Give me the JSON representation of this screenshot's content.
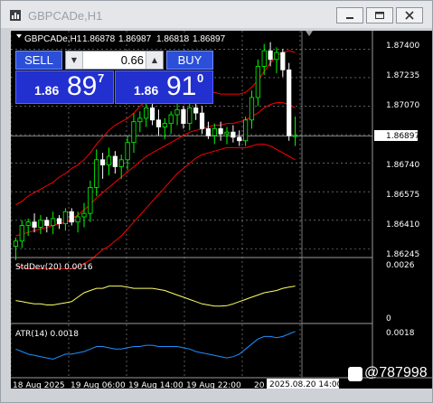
{
  "window": {
    "title": "GBPCADe,H1",
    "controls": [
      "minimize-icon",
      "maximize-icon",
      "close-icon"
    ]
  },
  "chart_header": {
    "symbol": "GBPCADe,H1",
    "open": "1.86878",
    "high": "1.86987",
    "low": "1.86818",
    "close": "1.86897"
  },
  "one_click": {
    "sell_label": "SELL",
    "buy_label": "BUY",
    "lot_value": "0.66",
    "sell_small": "1.86",
    "sell_big": "89",
    "sell_sup": "7",
    "buy_small": "1.86",
    "buy_big": "91",
    "buy_sup": "0"
  },
  "price_axis": [
    "1.87400",
    "1.87235",
    "1.87070",
    "1.86897",
    "1.86740",
    "1.86575",
    "1.86410",
    "1.86245"
  ],
  "current_price": "1.86897",
  "stddev": {
    "label": "StdDev(20) 0.0016",
    "top": "0.0026",
    "bottom": "0"
  },
  "atr": {
    "label": "ATR(14) 0.0018",
    "top": "0.0018"
  },
  "time_axis": [
    "18 Aug 2025",
    "19 Aug 06:00",
    "19 Aug 14:00",
    "19 Aug 22:00",
    "20 Aug"
  ],
  "crosshair_time": "2025.08.20 14:00",
  "watermark": "@787998",
  "colors": {
    "bull": "#00ff00",
    "bear": "#ffffff",
    "bands": "#ff0000",
    "stddev": "#ffff66",
    "atr": "#1e90ff",
    "grid": "#9a9a9a"
  },
  "chart_data": {
    "type": "candlestick",
    "ylim": [
      1.862,
      1.8748
    ],
    "candles": [
      [
        1.8626,
        1.8631,
        1.8618,
        1.8629
      ],
      [
        1.8629,
        1.8641,
        1.8625,
        1.8638
      ],
      [
        1.8638,
        1.8642,
        1.8632,
        1.864
      ],
      [
        1.864,
        1.8645,
        1.8634,
        1.8637
      ],
      [
        1.8637,
        1.8644,
        1.8633,
        1.8641
      ],
      [
        1.8641,
        1.8643,
        1.8634,
        1.8638
      ],
      [
        1.8638,
        1.8646,
        1.8633,
        1.8642
      ],
      [
        1.8642,
        1.8644,
        1.8636,
        1.8639
      ],
      [
        1.8639,
        1.8648,
        1.8635,
        1.8646
      ],
      [
        1.8646,
        1.8648,
        1.8638,
        1.864
      ],
      [
        1.864,
        1.8646,
        1.8634,
        1.8643
      ],
      [
        1.8643,
        1.8651,
        1.8637,
        1.8645
      ],
      [
        1.8645,
        1.8664,
        1.864,
        1.866
      ],
      [
        1.866,
        1.8682,
        1.8655,
        1.8676
      ],
      [
        1.8676,
        1.868,
        1.8665,
        1.8673
      ],
      [
        1.8673,
        1.8683,
        1.8667,
        1.8678
      ],
      [
        1.8678,
        1.8681,
        1.8668,
        1.8672
      ],
      [
        1.8672,
        1.8679,
        1.8665,
        1.8676
      ],
      [
        1.8676,
        1.869,
        1.867,
        1.8686
      ],
      [
        1.8686,
        1.8703,
        1.868,
        1.8698
      ],
      [
        1.8698,
        1.8704,
        1.8692,
        1.87
      ],
      [
        1.87,
        1.8712,
        1.8695,
        1.8706
      ],
      [
        1.8706,
        1.871,
        1.8696,
        1.8699
      ],
      [
        1.8699,
        1.8705,
        1.869,
        1.8695
      ],
      [
        1.8695,
        1.87,
        1.8688,
        1.8697
      ],
      [
        1.8697,
        1.8704,
        1.8691,
        1.8702
      ],
      [
        1.8702,
        1.8709,
        1.8696,
        1.8705
      ],
      [
        1.8705,
        1.8707,
        1.8694,
        1.8697
      ],
      [
        1.8697,
        1.8709,
        1.8693,
        1.8706
      ],
      [
        1.8706,
        1.8712,
        1.8699,
        1.8703
      ],
      [
        1.8703,
        1.8707,
        1.8691,
        1.8694
      ],
      [
        1.8694,
        1.8698,
        1.8688,
        1.869
      ],
      [
        1.869,
        1.8697,
        1.8685,
        1.8694
      ],
      [
        1.8694,
        1.8698,
        1.8687,
        1.8691
      ],
      [
        1.8691,
        1.8695,
        1.8685,
        1.8692
      ],
      [
        1.8692,
        1.8696,
        1.8686,
        1.8689
      ],
      [
        1.8689,
        1.8693,
        1.8684,
        1.8687
      ],
      [
        1.8687,
        1.8701,
        1.8684,
        1.8699
      ],
      [
        1.8699,
        1.8716,
        1.8694,
        1.8712
      ],
      [
        1.8712,
        1.8734,
        1.8707,
        1.873
      ],
      [
        1.873,
        1.8743,
        1.8725,
        1.8739
      ],
      [
        1.8739,
        1.8744,
        1.873,
        1.8734
      ],
      [
        1.8734,
        1.8741,
        1.8726,
        1.8738
      ],
      [
        1.8738,
        1.874,
        1.8724,
        1.8728
      ],
      [
        1.8728,
        1.8732,
        1.8687,
        1.869
      ],
      [
        1.869,
        1.8701,
        1.8684,
        1.869
      ]
    ],
    "bb_upper": [
      1.865,
      1.8652,
      1.8655,
      1.8657,
      1.8659,
      1.8661,
      1.8663,
      1.8666,
      1.8668,
      1.8671,
      1.8673,
      1.8676,
      1.868,
      1.8685,
      1.8689,
      1.8693,
      1.8696,
      1.8698,
      1.87,
      1.8703,
      1.8707,
      1.871,
      1.8712,
      1.8713,
      1.8714,
      1.8715,
      1.8716,
      1.8716,
      1.8716,
      1.8716,
      1.8716,
      1.8715,
      1.8715,
      1.8714,
      1.8714,
      1.8714,
      1.8714,
      1.8715,
      1.8718,
      1.8722,
      1.8727,
      1.8732,
      1.8736,
      1.8738,
      1.8739,
      1.8738
    ],
    "bb_mid": [
      1.8632,
      1.8633,
      1.8634,
      1.8635,
      1.8636,
      1.8637,
      1.8638,
      1.8639,
      1.864,
      1.8642,
      1.8644,
      1.8647,
      1.865,
      1.8654,
      1.8657,
      1.866,
      1.8663,
      1.8666,
      1.8669,
      1.8672,
      1.8675,
      1.8678,
      1.868,
      1.8682,
      1.8684,
      1.8686,
      1.8688,
      1.869,
      1.8692,
      1.8693,
      1.8694,
      1.8695,
      1.8696,
      1.8696,
      1.8697,
      1.8697,
      1.8698,
      1.8699,
      1.8701,
      1.8703,
      1.8706,
      1.8708,
      1.8709,
      1.8709,
      1.8708,
      1.8706
    ],
    "bb_lower": [
      1.8615,
      1.8614,
      1.8613,
      1.8613,
      1.8613,
      1.8613,
      1.8613,
      1.8613,
      1.8613,
      1.8613,
      1.8614,
      1.8616,
      1.8618,
      1.8621,
      1.8624,
      1.8626,
      1.8629,
      1.8632,
      1.8636,
      1.864,
      1.8644,
      1.8648,
      1.8652,
      1.8656,
      1.866,
      1.8664,
      1.8668,
      1.8671,
      1.8674,
      1.8677,
      1.8679,
      1.868,
      1.8681,
      1.8682,
      1.8683,
      1.8683,
      1.8683,
      1.8683,
      1.8684,
      1.8685,
      1.8685,
      1.8684,
      1.8682,
      1.868,
      1.8678,
      1.8676
    ],
    "stddev_series": [
      0.00095,
      0.0009,
      0.00085,
      0.0008,
      0.0008,
      0.00075,
      0.00075,
      0.0008,
      0.00085,
      0.0009,
      0.0011,
      0.0013,
      0.0014,
      0.0015,
      0.0015,
      0.0016,
      0.0016,
      0.0016,
      0.00155,
      0.0015,
      0.0015,
      0.0015,
      0.0015,
      0.00145,
      0.0014,
      0.0013,
      0.0012,
      0.0011,
      0.001,
      0.0009,
      0.0008,
      0.00075,
      0.0007,
      0.0007,
      0.00072,
      0.0008,
      0.0009,
      0.001,
      0.0011,
      0.0012,
      0.0013,
      0.00135,
      0.0014,
      0.0015,
      0.00155,
      0.0016
    ],
    "atr_series": [
      0.0011,
      0.001,
      0.0009,
      0.00085,
      0.0008,
      0.00075,
      0.0007,
      0.0008,
      0.0009,
      0.0009,
      0.00095,
      0.001,
      0.0011,
      0.0012,
      0.0012,
      0.00115,
      0.0011,
      0.0011,
      0.00115,
      0.0012,
      0.0012,
      0.00125,
      0.00125,
      0.0012,
      0.0012,
      0.0012,
      0.0012,
      0.00115,
      0.0011,
      0.001,
      0.00095,
      0.0009,
      0.00085,
      0.0008,
      0.00075,
      0.0008,
      0.0009,
      0.0011,
      0.0013,
      0.0015,
      0.0016,
      0.0016,
      0.00155,
      0.0016,
      0.0017,
      0.0018
    ],
    "stddev_range": [
      0,
      0.0026
    ],
    "atr_range": [
      0,
      0.0019
    ]
  }
}
